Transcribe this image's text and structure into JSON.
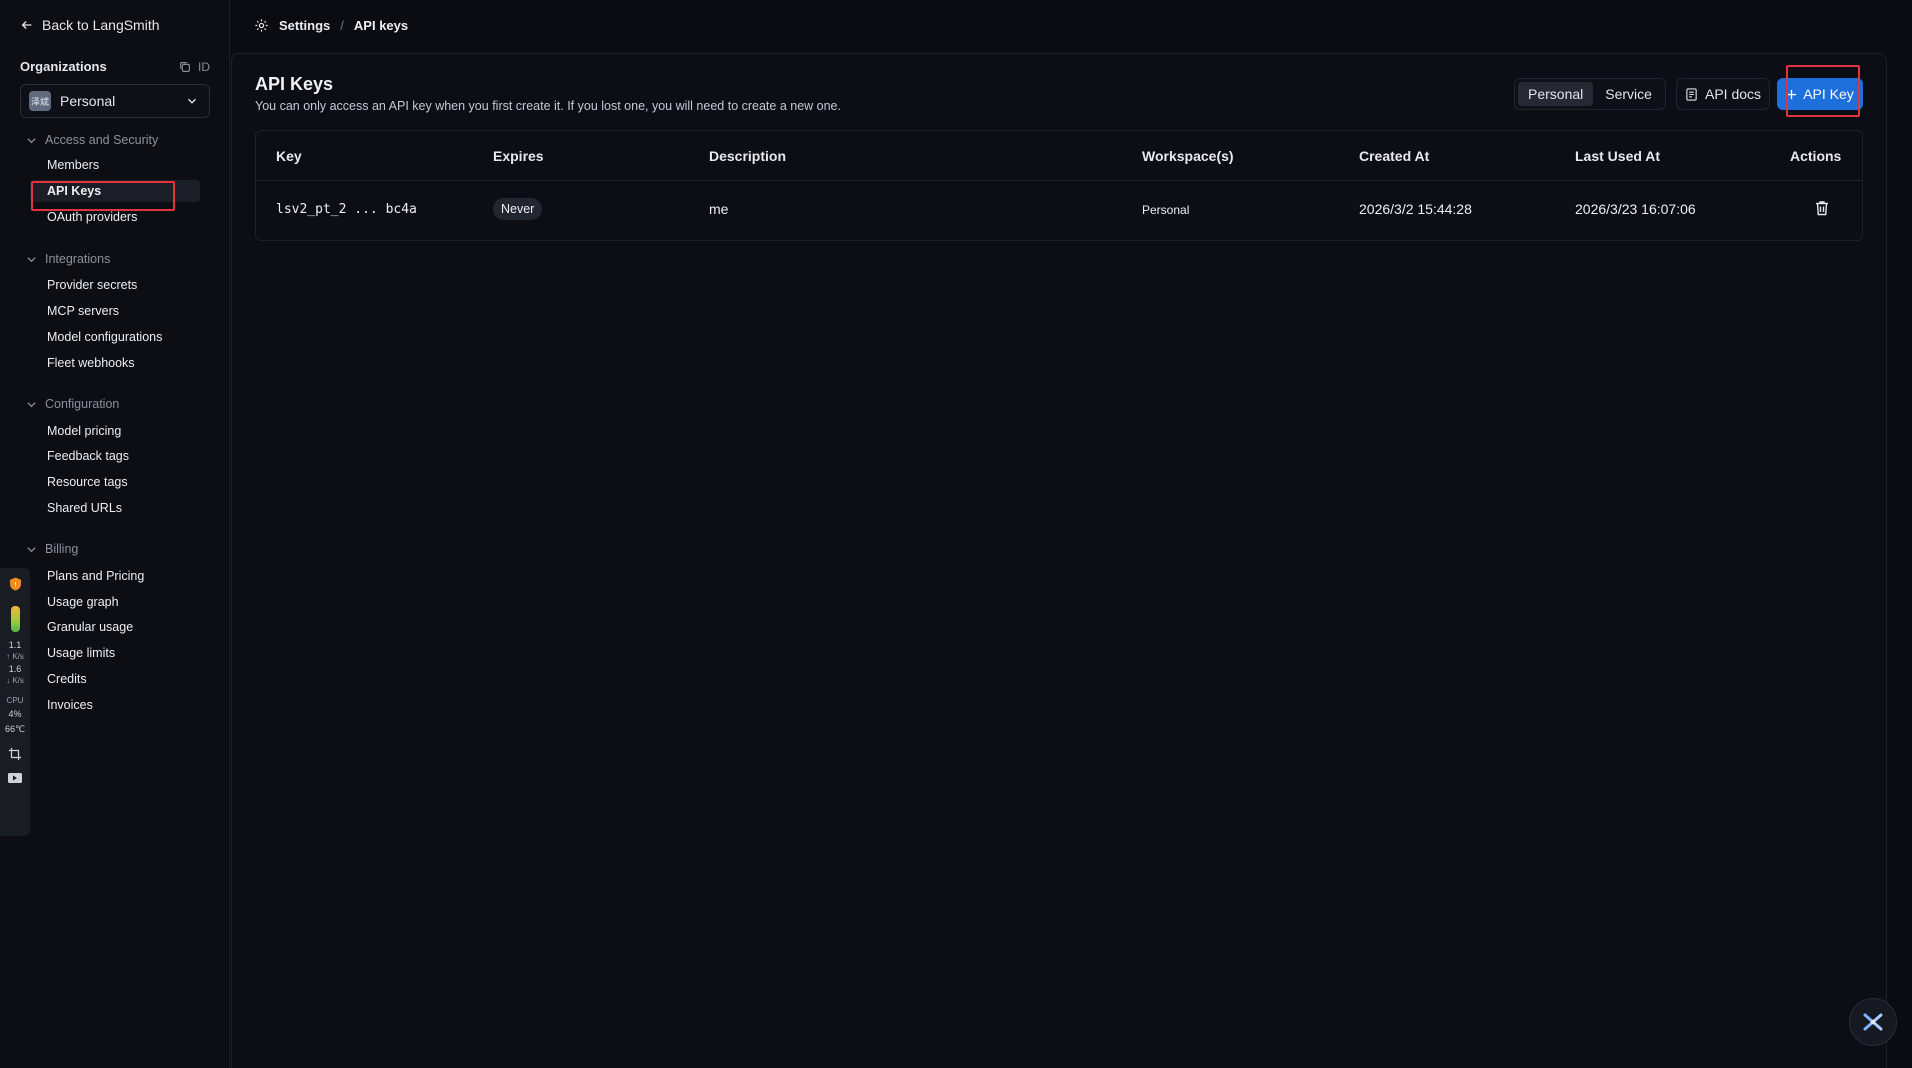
{
  "sidebar": {
    "back_label": "Back to LangSmith",
    "org_title": "Organizations",
    "org_id_label": "ID",
    "org_avatar_text": "泽斌",
    "org_selected": "Personal",
    "groups": [
      {
        "label": "Access and Security",
        "items": [
          "Members",
          "API Keys",
          "OAuth providers"
        ]
      },
      {
        "label": "Integrations",
        "items": [
          "Provider secrets",
          "MCP servers",
          "Model configurations",
          "Fleet webhooks"
        ]
      },
      {
        "label": "Configuration",
        "items": [
          "Model pricing",
          "Feedback tags",
          "Resource tags",
          "Shared URLs"
        ]
      },
      {
        "label": "Billing",
        "items": [
          "Plans and Pricing",
          "Usage graph",
          "Granular usage",
          "Usage limits",
          "Credits",
          "Invoices"
        ]
      }
    ],
    "active_item": "API Keys"
  },
  "sysmon": {
    "up_value": "1.1",
    "up_unit": "K/s",
    "down_value": "1.6",
    "down_unit": "K/s",
    "cpu_label": "CPU",
    "cpu_value": "4%",
    "temp_value": "66℃"
  },
  "breadcrumb": {
    "settings": "Settings",
    "separator": "/",
    "current": "API keys"
  },
  "main": {
    "title": "API Keys",
    "subtitle": "You can only access an API key when you first create it. If you lost one, you will need to create a new one.",
    "toggle": {
      "personal": "Personal",
      "service": "Service",
      "selected": "Personal"
    },
    "docs_label": "API docs",
    "add_label": "API Key",
    "table": {
      "headers": [
        "Key",
        "Expires",
        "Description",
        "Workspace(s)",
        "Created At",
        "Last Used At",
        "Actions"
      ],
      "rows": [
        {
          "key": "lsv2_pt_2 ... bc4a",
          "expires": "Never",
          "description": "me",
          "workspace": "Personal",
          "created": "2026/3/2 15:44:28",
          "last_used": "2026/3/23 16:07:06"
        }
      ]
    }
  },
  "colors": {
    "accent": "#1d6fdc",
    "highlight": "#e0353e",
    "background": "#0b0c12"
  }
}
